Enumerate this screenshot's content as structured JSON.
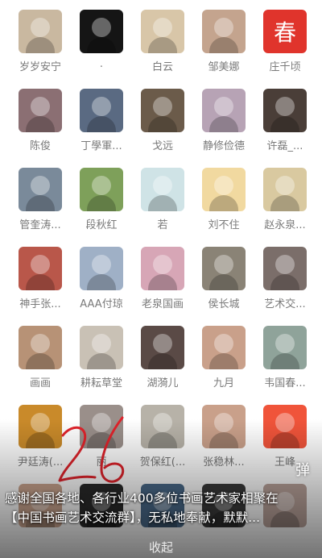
{
  "members": [
    {
      "name": "岁岁安宁",
      "color": "#c9b8a0"
    },
    {
      "name": ".",
      "color": "#151515"
    },
    {
      "name": "白云",
      "color": "#d8c6a8"
    },
    {
      "name": "邹美娜",
      "color": "#c4a48e"
    },
    {
      "name": "庄千顷",
      "color": "#e0342c",
      "glyph": "春"
    },
    {
      "name": "陈俊",
      "color": "#8b6f73"
    },
    {
      "name": "丁學軍...",
      "color": "#5a6a82"
    },
    {
      "name": "戈远",
      "color": "#6b5b4a"
    },
    {
      "name": "静修俭德",
      "color": "#b7a3b5"
    },
    {
      "name": "许磊_...",
      "color": "#4a3e38"
    },
    {
      "name": "管奎涛...",
      "color": "#7a8a9a"
    },
    {
      "name": "段秋红",
      "color": "#7ea05a"
    },
    {
      "name": "若",
      "color": "#cfe3e6"
    },
    {
      "name": "刘不住",
      "color": "#f1d9a0"
    },
    {
      "name": "赵永泉...",
      "color": "#d9c9a0"
    },
    {
      "name": "神手张...",
      "color": "#b9574a"
    },
    {
      "name": "AAA付琼",
      "color": "#9fb0c6"
    },
    {
      "name": "老泉国画",
      "color": "#d7a6b6"
    },
    {
      "name": "侯长城",
      "color": "#8a8376"
    },
    {
      "name": "艺术交...",
      "color": "#7b6e6a"
    },
    {
      "name": "画画",
      "color": "#b79276"
    },
    {
      "name": "耕耘草堂",
      "color": "#c9c1b5"
    },
    {
      "name": "湖漪儿",
      "color": "#5a4a46"
    },
    {
      "name": "九月",
      "color": "#c9a08a"
    },
    {
      "name": "韦国春...",
      "color": "#8fa39a"
    },
    {
      "name": "尹廷涛(...",
      "color": "#c98a2a"
    },
    {
      "name": "丽",
      "color": "#9a8f8a"
    },
    {
      "name": "贺保红(...",
      "color": "#b7b2a8"
    },
    {
      "name": "张稳林...",
      "color": "#c9a08a"
    },
    {
      "name": "王峰",
      "color": "#f0543a"
    },
    {
      "name": "",
      "color": "#caa48e"
    },
    {
      "name": "",
      "color": "#2a2a2a"
    },
    {
      "name": "",
      "color": "#4a6a8a"
    },
    {
      "name": "",
      "color": "#3a3a3a"
    },
    {
      "name": "",
      "color": "#b9a29a"
    }
  ],
  "caption": {
    "line1": "感谢全国各地、各行业400多位书画艺术家相聚在",
    "line2": "【中国书画艺术交流群】，无私地奉献，默默..."
  },
  "danmaku_label": "弹",
  "collapse_label": "收起",
  "handwritten_number": "26",
  "colors": {
    "name_text": "#7a7a7a",
    "handwriting": "#e0232b",
    "caption_text": "#ffffff"
  }
}
